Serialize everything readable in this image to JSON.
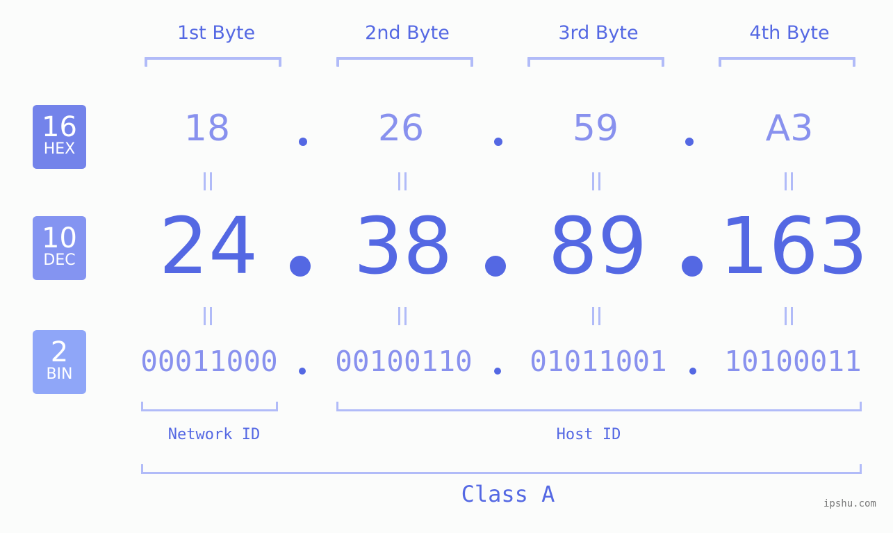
{
  "bytes": [
    {
      "label": "1st Byte",
      "hex": "18",
      "dec": "24",
      "bin": "00011000"
    },
    {
      "label": "2nd Byte",
      "hex": "26",
      "dec": "38",
      "bin": "00100110"
    },
    {
      "label": "3rd Byte",
      "hex": "59",
      "dec": "89",
      "bin": "01011001"
    },
    {
      "label": "4th Byte",
      "hex": "A3",
      "dec": "163",
      "bin": "10100011"
    }
  ],
  "badges": {
    "hex": {
      "num": "16",
      "sub": "HEX",
      "color": "#7383ea"
    },
    "dec": {
      "num": "10",
      "sub": "DEC",
      "color": "#8494f1"
    },
    "bin": {
      "num": "2",
      "sub": "BIN",
      "color": "#8fa6f8"
    }
  },
  "network_id_label": "Network ID",
  "host_id_label": "Host ID",
  "class_label": "Class A",
  "watermark": "ipshu.com",
  "colors": {
    "primary": "#5468e3",
    "light": "#8891ee",
    "bracket": "#b1bbf8",
    "background": "#fbfcfb"
  }
}
